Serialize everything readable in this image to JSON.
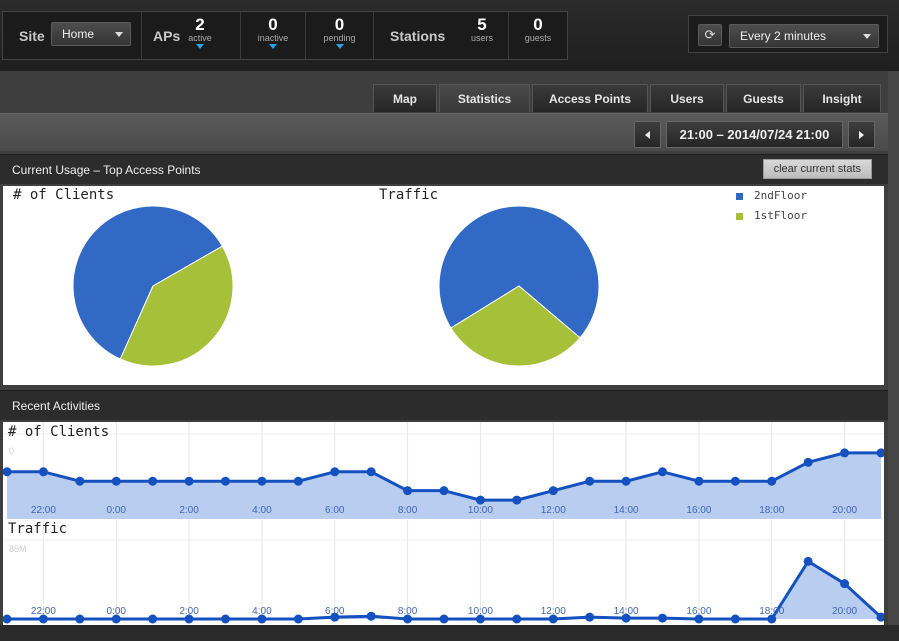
{
  "topbar": {
    "site_label": "Site",
    "site_value": "Home",
    "aps_label": "APs",
    "active": {
      "num": "2",
      "label": "active"
    },
    "inactive": {
      "num": "0",
      "label": "inactive"
    },
    "pending": {
      "num": "0",
      "label": "pending"
    },
    "stations_label": "Stations",
    "users": {
      "num": "5",
      "label": "users"
    },
    "guests": {
      "num": "0",
      "label": "guests"
    },
    "refresh_icon": "refresh-icon",
    "refresh_glyph": "⟳",
    "interval_value": "Every 2 minutes"
  },
  "tabs": [
    {
      "label": "Map"
    },
    {
      "label": "Statistics",
      "active": true
    },
    {
      "label": "Access Points"
    },
    {
      "label": "Users"
    },
    {
      "label": "Guests"
    },
    {
      "label": "Insight"
    }
  ],
  "range": {
    "label": "21:00 – 2014/07/24 21:00"
  },
  "current_usage": {
    "title": "Current Usage – Top Access Points",
    "clear_button": "clear current stats",
    "clients_title": "# of Clients",
    "traffic_title": "Traffic",
    "legend": [
      {
        "name": "2ndFloor",
        "color": "#3169c4"
      },
      {
        "name": "1stFloor",
        "color": "#a7c03a"
      }
    ]
  },
  "recent": {
    "title": "Recent Activities",
    "clients_title": "# of Clients",
    "traffic_title": "Traffic",
    "clients_ytick": "0",
    "traffic_ytick": "85M"
  },
  "chart_data": [
    {
      "type": "pie",
      "title": "# of Clients",
      "categories": [
        "2ndFloor",
        "1stFloor"
      ],
      "values": [
        3,
        2
      ],
      "colors": [
        "#3169c4",
        "#a7c03a"
      ]
    },
    {
      "type": "pie",
      "title": "Traffic",
      "categories": [
        "2ndFloor",
        "1stFloor"
      ],
      "values": [
        70,
        30
      ],
      "colors": [
        "#3169c4",
        "#a7c03a"
      ]
    },
    {
      "type": "area",
      "title": "# of Clients",
      "x": [
        "21:00",
        "22:00",
        "23:00",
        "0:00",
        "1:00",
        "2:00",
        "3:00",
        "4:00",
        "5:00",
        "6:00",
        "7:00",
        "8:00",
        "9:00",
        "10:00",
        "11:00",
        "12:00",
        "13:00",
        "14:00",
        "15:00",
        "16:00",
        "17:00",
        "18:00",
        "19:00",
        "20:00",
        "21:00"
      ],
      "x_ticks": [
        "22:00",
        "0:00",
        "2:00",
        "4:00",
        "6:00",
        "8:00",
        "10:00",
        "12:00",
        "14:00",
        "16:00",
        "18:00",
        "20:00"
      ],
      "y": [
        5,
        5,
        4,
        4,
        4,
        4,
        4,
        4,
        4,
        5,
        5,
        3,
        3,
        2,
        2,
        3,
        4,
        4,
        5,
        4,
        4,
        4,
        6,
        7,
        7
      ],
      "ylim": [
        0,
        9
      ],
      "color": "#1550c0",
      "fill": "#b8cdf0"
    },
    {
      "type": "area",
      "title": "Traffic",
      "x": [
        "21:00",
        "22:00",
        "23:00",
        "0:00",
        "1:00",
        "2:00",
        "3:00",
        "4:00",
        "5:00",
        "6:00",
        "7:00",
        "8:00",
        "9:00",
        "10:00",
        "11:00",
        "12:00",
        "13:00",
        "14:00",
        "15:00",
        "16:00",
        "17:00",
        "18:00",
        "19:00",
        "20:00",
        "21:00"
      ],
      "x_ticks": [
        "22:00",
        "0:00",
        "2:00",
        "4:00",
        "6:00",
        "8:00",
        "10:00",
        "12:00",
        "14:00",
        "16:00",
        "18:00",
        "20:00"
      ],
      "y": [
        0,
        0,
        0,
        0,
        0,
        0,
        0,
        0,
        0,
        2,
        3,
        0,
        0,
        0,
        0,
        0,
        2,
        1,
        1,
        0,
        0,
        0,
        62,
        38,
        2
      ],
      "ylim": [
        0,
        85
      ],
      "y_ticks": [
        "85M"
      ],
      "color": "#1550c0",
      "fill": "#b8cdf0"
    }
  ]
}
